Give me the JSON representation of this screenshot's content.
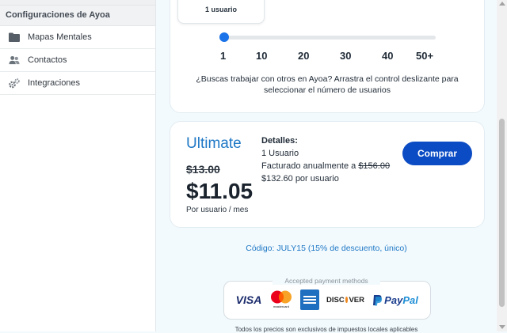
{
  "sidebar": {
    "section_title": "Configuraciones de Ayoa",
    "items": [
      {
        "label": "Mapas Mentales",
        "icon": "folder-icon"
      },
      {
        "label": "Contactos",
        "icon": "contacts-icon"
      },
      {
        "label": "Integraciones",
        "icon": "gears-icon"
      }
    ]
  },
  "slider": {
    "tooltip": "1 usuario",
    "ticks": [
      "1",
      "10",
      "20",
      "30",
      "40",
      "50+"
    ],
    "hint_line1": "¿Buscas trabajar con otros en Ayoa? Arrastra el control deslizante para",
    "hint_line2": "seleccionar el número de usuarios"
  },
  "plan": {
    "name": "Ultimate",
    "old_price": "$13.00",
    "price": "$11.05",
    "per": "Por usuario / mes",
    "details_heading": "Detalles:",
    "details_users": "1 Usuario",
    "details_billed": "Facturado anualmente a",
    "details_billed_old": "$156.00",
    "details_per_user": "$132.60 por usuario",
    "buy_label": "Comprar"
  },
  "promo": "Código: JULY15 (15% de descuento, único)",
  "payments": {
    "label": "Accepted payment methods",
    "visa": "VISA",
    "mastercard": "mastercard",
    "discover_a": "DISC",
    "discover_b": "VER",
    "paypal_a": "Pay",
    "paypal_b": "Pal"
  },
  "disclaimer": "Todos los precios son exclusivos de impuestos locales aplicables",
  "colors": {
    "accent": "#0b4bc4",
    "link": "#1f78c6",
    "slider": "#1a73e8"
  }
}
